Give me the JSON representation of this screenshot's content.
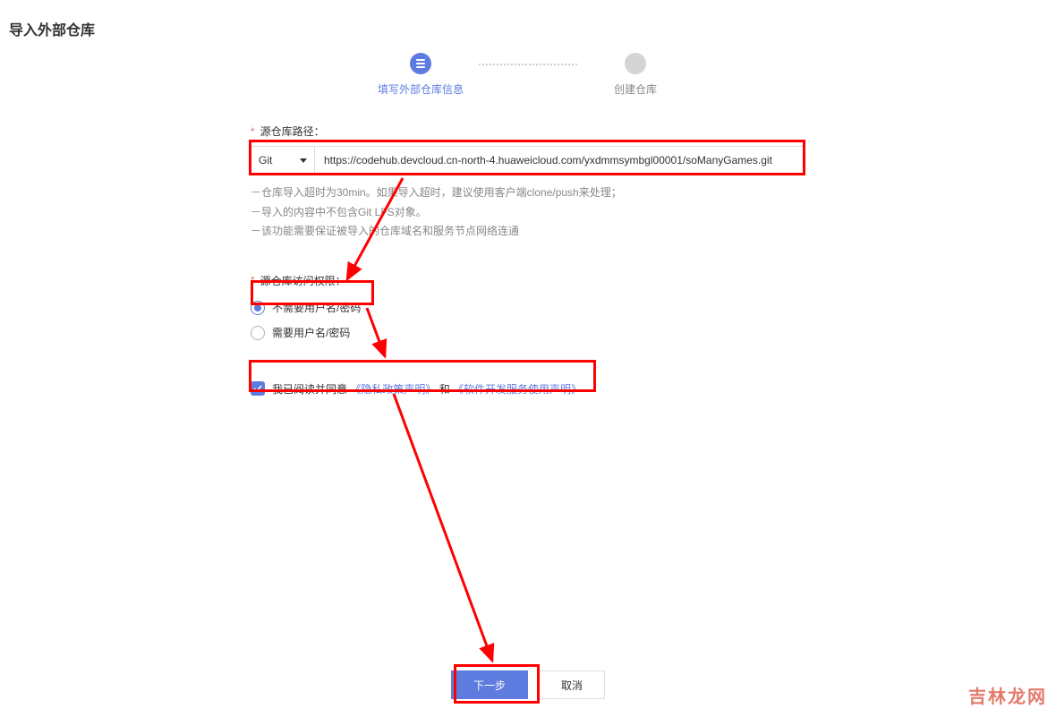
{
  "page": {
    "title": "导入外部仓库"
  },
  "stepper": {
    "step1": "填写外部仓库信息",
    "step2": "创建仓库"
  },
  "source": {
    "label": "源仓库路径：",
    "protocol": "Git",
    "url": "https://codehub.devcloud.cn-north-4.huaweicloud.com/yxdmmsymbgl00001/soManyGames.git",
    "hint1": "－仓库导入超时为30min。如果导入超时，建议使用客户端clone/push来处理；",
    "hint2": "－导入的内容中不包含Git LFS对象。",
    "hint3": "－该功能需要保证被导入的仓库域名和服务节点网络连通"
  },
  "access": {
    "label": "源仓库访问权限：",
    "opt_no_auth": "不需要用户名/密码",
    "opt_auth": "需要用户名/密码"
  },
  "agreement": {
    "prefix": "我已阅读并同意 ",
    "link1": "《隐私政策声明》",
    "joiner": " 和 ",
    "link2": "《软件开发服务使用声明》"
  },
  "footer": {
    "next": "下一步",
    "cancel": "取消"
  },
  "watermark": "吉林龙网"
}
